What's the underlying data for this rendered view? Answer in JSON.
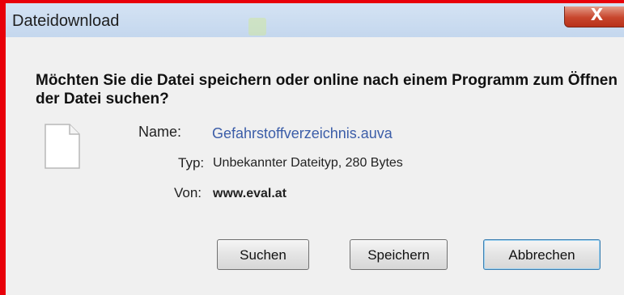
{
  "window": {
    "title": "Dateidownload",
    "close_label": "X"
  },
  "dialog": {
    "question": "Möchten Sie die Datei speichern oder online nach einem Programm zum Öffnen der Datei suchen?",
    "fields": {
      "name_label": "Name:",
      "name_value": "Gefahrstoffverzeichnis.auva",
      "type_label": "Typ:",
      "type_value": "Unbekannter Dateityp, 280 Bytes",
      "from_label": "Von:",
      "from_value": "www.eval.at"
    },
    "file_icon": "blank-file-icon"
  },
  "buttons": {
    "search": "Suchen",
    "save": "Speichern",
    "cancel": "Abbrechen"
  },
  "colors": {
    "highlight_border": "#e8000a",
    "title_bar": "#c9dbf0",
    "dialog_background": "#f0f0f0",
    "filename_link": "#3b5da8",
    "close_button": "#c7462d"
  }
}
